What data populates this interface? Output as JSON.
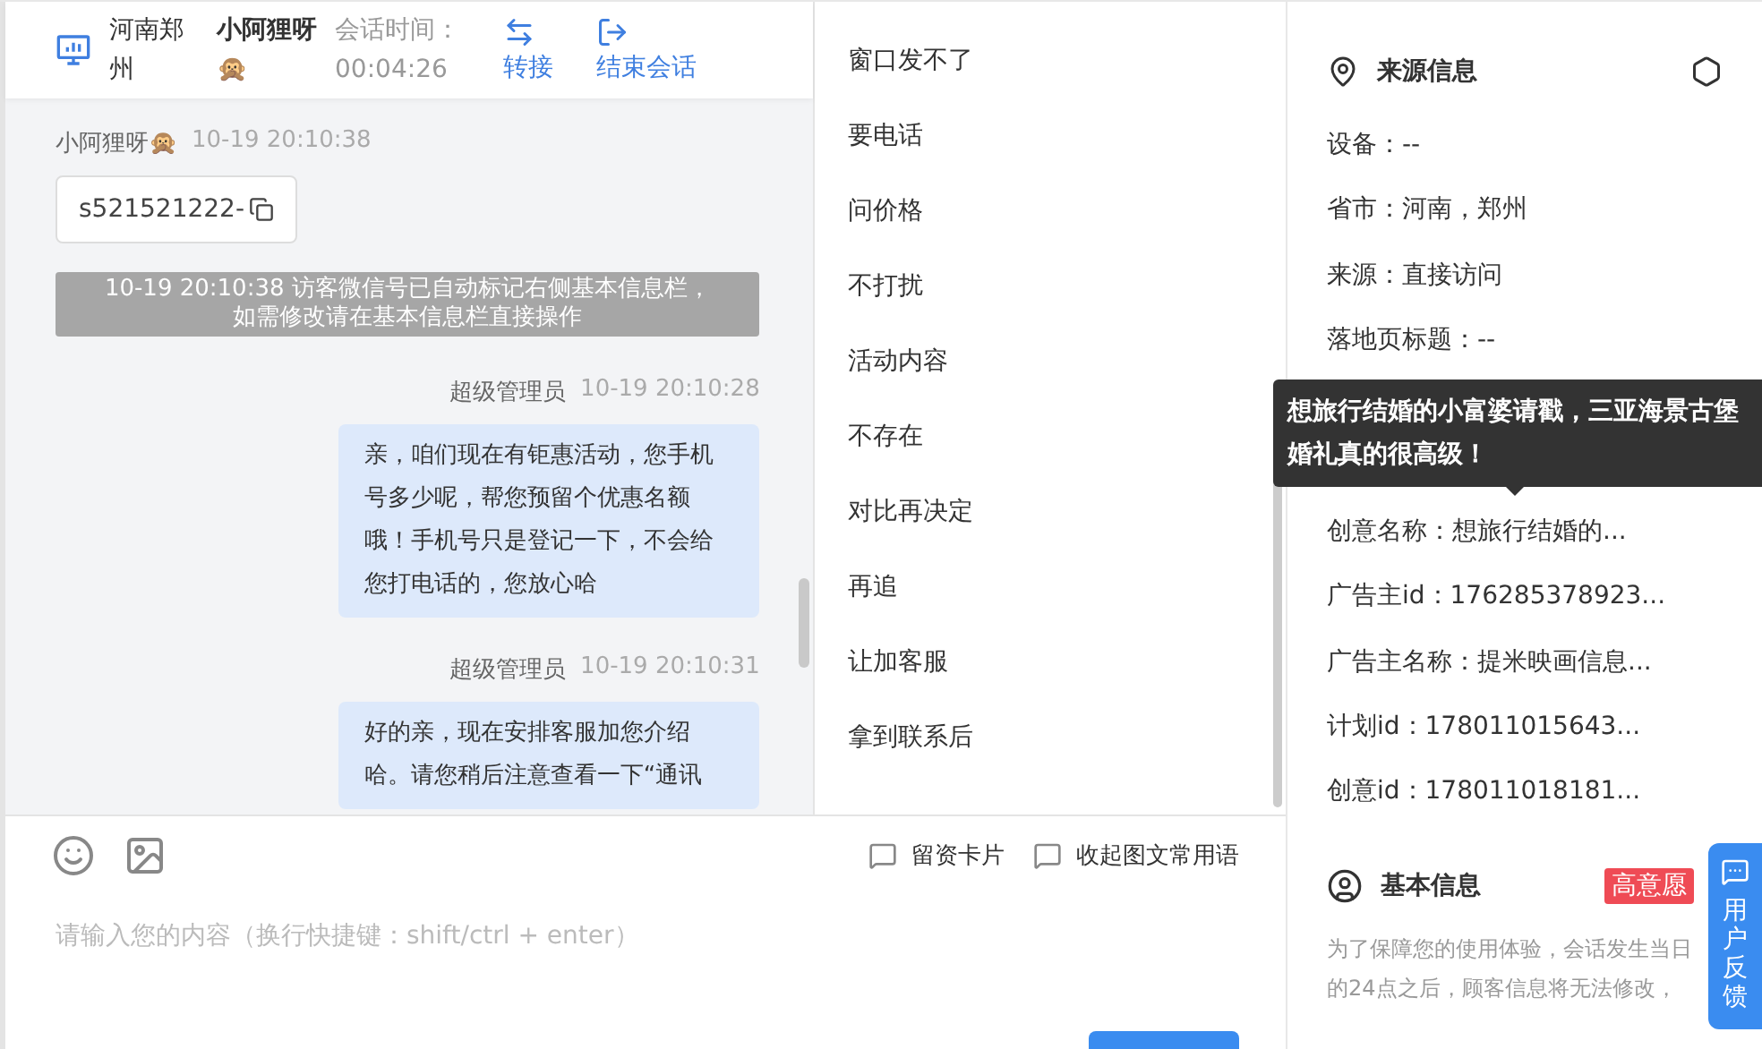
{
  "header": {
    "location": "河南郑州",
    "visitor": "小阿狸呀🙊",
    "duration_label": "会话时间：",
    "duration": "00:04:26",
    "actions": [
      {
        "kind": "transfer",
        "label": "转接"
      },
      {
        "kind": "end",
        "label": "结束会话"
      }
    ]
  },
  "messages": [
    {
      "kind": "visitor",
      "sender": "小阿狸呀🙊",
      "time": "10-19 20:10:38",
      "text": "s521521222-"
    },
    {
      "kind": "system",
      "text": "10-19 20:10:38 访客微信号已自动标记右侧基本信息栏，如需修改请在基本信息栏直接操作"
    },
    {
      "kind": "agent",
      "sender": "超级管理员",
      "time": "10-19 20:10:28",
      "text": "亲，咱们现在有钜惠活动，您手机号多少呢，帮您预留个优惠名额哦！手机号只是登记一下，不会给您打电话的，您放心哈"
    },
    {
      "kind": "agent",
      "sender": "超级管理员",
      "time": "10-19 20:10:31",
      "text": "好的亲，现在安排客服加您介绍哈。请您稍后注意查看一下“通讯"
    }
  ],
  "composer": {
    "tools": [
      "留资卡片",
      "收起图文常用语"
    ],
    "placeholder": "请输入您的内容（换行快捷键：shift/ctrl + enter）"
  },
  "quick_replies": [
    "窗口发不了",
    "要电话",
    "问价格",
    "不打扰",
    "活动内容",
    "不存在",
    "对比再决定",
    "再追",
    "让加客服",
    "拿到联系后"
  ],
  "source_info": {
    "title": "来源信息",
    "rows": [
      "设备：--",
      "省市：河南，郑州",
      "来源：直接访问",
      "落地页标题：--"
    ],
    "tooltip": "想旅行结婚的小富婆请戳，三亚海景古堡婚礼真的很高级！",
    "rows_below_tooltip": [
      "创意名称：想旅行结婚的...",
      "广告主id：176285378923...",
      "广告主名称：提米映画信息...",
      "计划id：178011015643...",
      "创意id：178011018181..."
    ]
  },
  "basic_info": {
    "title": "基本信息",
    "badge": "高意愿",
    "notice": "为了保障您的使用体验，会话发生当日的24点之后，顾客信息将无法修改，"
  },
  "feedback": {
    "label": "用户反馈"
  }
}
